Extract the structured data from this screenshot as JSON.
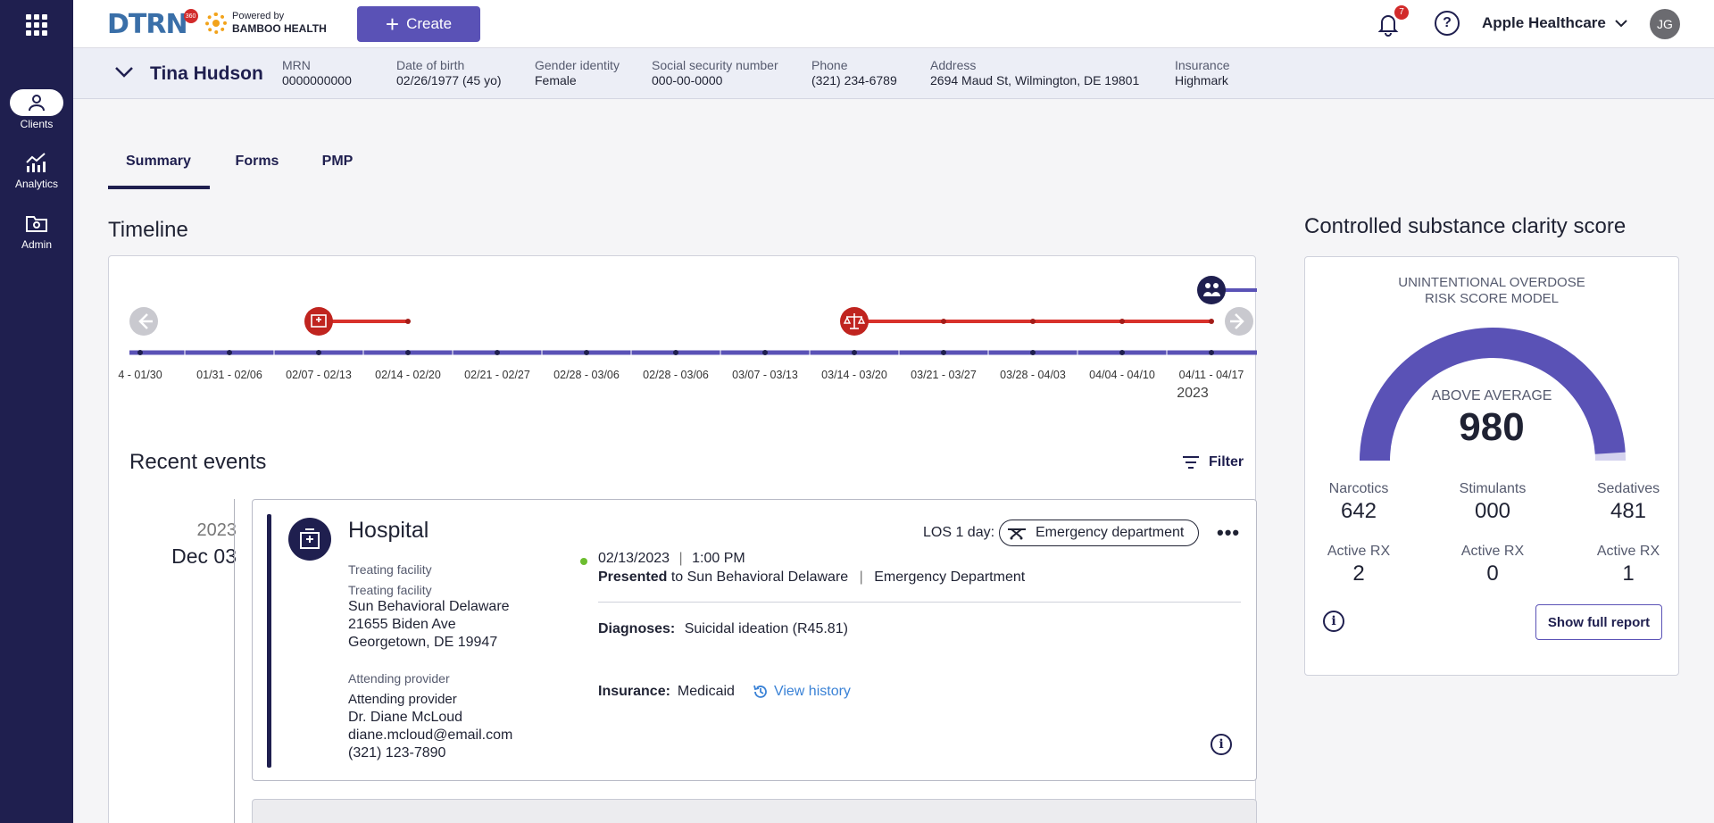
{
  "nav": {
    "items": [
      {
        "label": "Clients",
        "icon": "person-icon"
      },
      {
        "label": "Analytics",
        "icon": "chart-icon"
      },
      {
        "label": "Admin",
        "icon": "folder-gear-icon"
      }
    ]
  },
  "header": {
    "logo": "DTRN",
    "logo_badge": "360",
    "powered_small": "Powered by",
    "powered_big": "BAMBOO HEALTH",
    "create_label": "Create",
    "notification_count": "7",
    "help_symbol": "?",
    "org_name": "Apple Healthcare",
    "user_initials": "JG"
  },
  "patient": {
    "name": "Tina Hudson",
    "fields": [
      {
        "label": "MRN",
        "value": "0000000000"
      },
      {
        "label": "Date of birth",
        "value": "02/26/1977 (45 yo)"
      },
      {
        "label": "Gender identity",
        "value": "Female"
      },
      {
        "label": "Social security number",
        "value": "000-00-0000"
      },
      {
        "label": "Phone",
        "value": "(321) 234-6789"
      },
      {
        "label": "Address",
        "value": "2694 Maud St, Wilmington, DE 19801"
      },
      {
        "label": "Insurance",
        "value": "Highmark"
      }
    ]
  },
  "tabs": [
    {
      "label": "Summary",
      "active": true
    },
    {
      "label": "Forms",
      "active": false
    },
    {
      "label": "PMP",
      "active": false
    }
  ],
  "timeline": {
    "title": "Timeline",
    "weeks": [
      "4 - 01/30",
      "01/31 - 02/06",
      "02/07 - 02/13",
      "02/14 - 02/20",
      "02/21 - 02/27",
      "02/28 - 03/06",
      "02/28 - 03/06",
      "03/07 - 03/13",
      "03/14 - 03/20",
      "03/21 - 03/27",
      "03/28 - 04/03",
      "04/04 - 04/10",
      "04/11 - 04/17"
    ],
    "year": "2023",
    "colors": {
      "axis": "#5a52b6",
      "event": "#d8312b",
      "marker": "#1f1f4f"
    }
  },
  "recent": {
    "title": "Recent events",
    "filter_label": "Filter",
    "date_year": "2023",
    "date_day": "Dec 03",
    "event": {
      "title": "Hospital",
      "treating_label": "Treating facility",
      "treating_label2": "Treating facility",
      "facility_name": "Sun Behavioral Delaware",
      "facility_street": "21655 Biden Ave",
      "facility_city": "Georgetown, DE 19947",
      "attending_label": "Attending provider",
      "attending_label2": "Attending provider",
      "provider_name": "Dr. Diane McLoud",
      "provider_email": "diane.mcloud@email.com",
      "provider_phone": "(321) 123-7890",
      "los": "LOS 1 day:",
      "department_pill": "Emergency department",
      "date": "02/13/2023",
      "sep": "|",
      "time": "1:00 PM",
      "presented_bold": "Presented",
      "presented_rest": "to Sun Behavioral Delaware",
      "presented_sep": "|",
      "presented_dept": "Emergency Department",
      "diagnoses_label": "Diagnoses:",
      "diagnoses_value": "Suicidal ideation (R45.81)",
      "insurance_label": "Insurance:",
      "insurance_value": "Medicaid",
      "view_history": "View history",
      "more": "•••",
      "info_symbol": "i"
    }
  },
  "score": {
    "title": "Controlled substance clarity score",
    "model_line1": "UNINTENTIONAL OVERDOSE",
    "model_line2": "RISK SCORE MODEL",
    "level": "ABOVE AVERAGE",
    "value": "980",
    "gauge_fill": 0.98,
    "categories": [
      {
        "label": "Narcotics",
        "value": "642"
      },
      {
        "label": "Stimulants",
        "value": "000"
      },
      {
        "label": "Sedatives",
        "value": "481"
      }
    ],
    "active_rx": [
      {
        "label": "Active RX",
        "value": "2"
      },
      {
        "label": "Active RX",
        "value": "0"
      },
      {
        "label": "Active RX",
        "value": "1"
      }
    ],
    "info_symbol": "i",
    "report_label": "Show full report",
    "colors": {
      "fill": "#5a52b6",
      "track": "#d4d2ee"
    }
  }
}
